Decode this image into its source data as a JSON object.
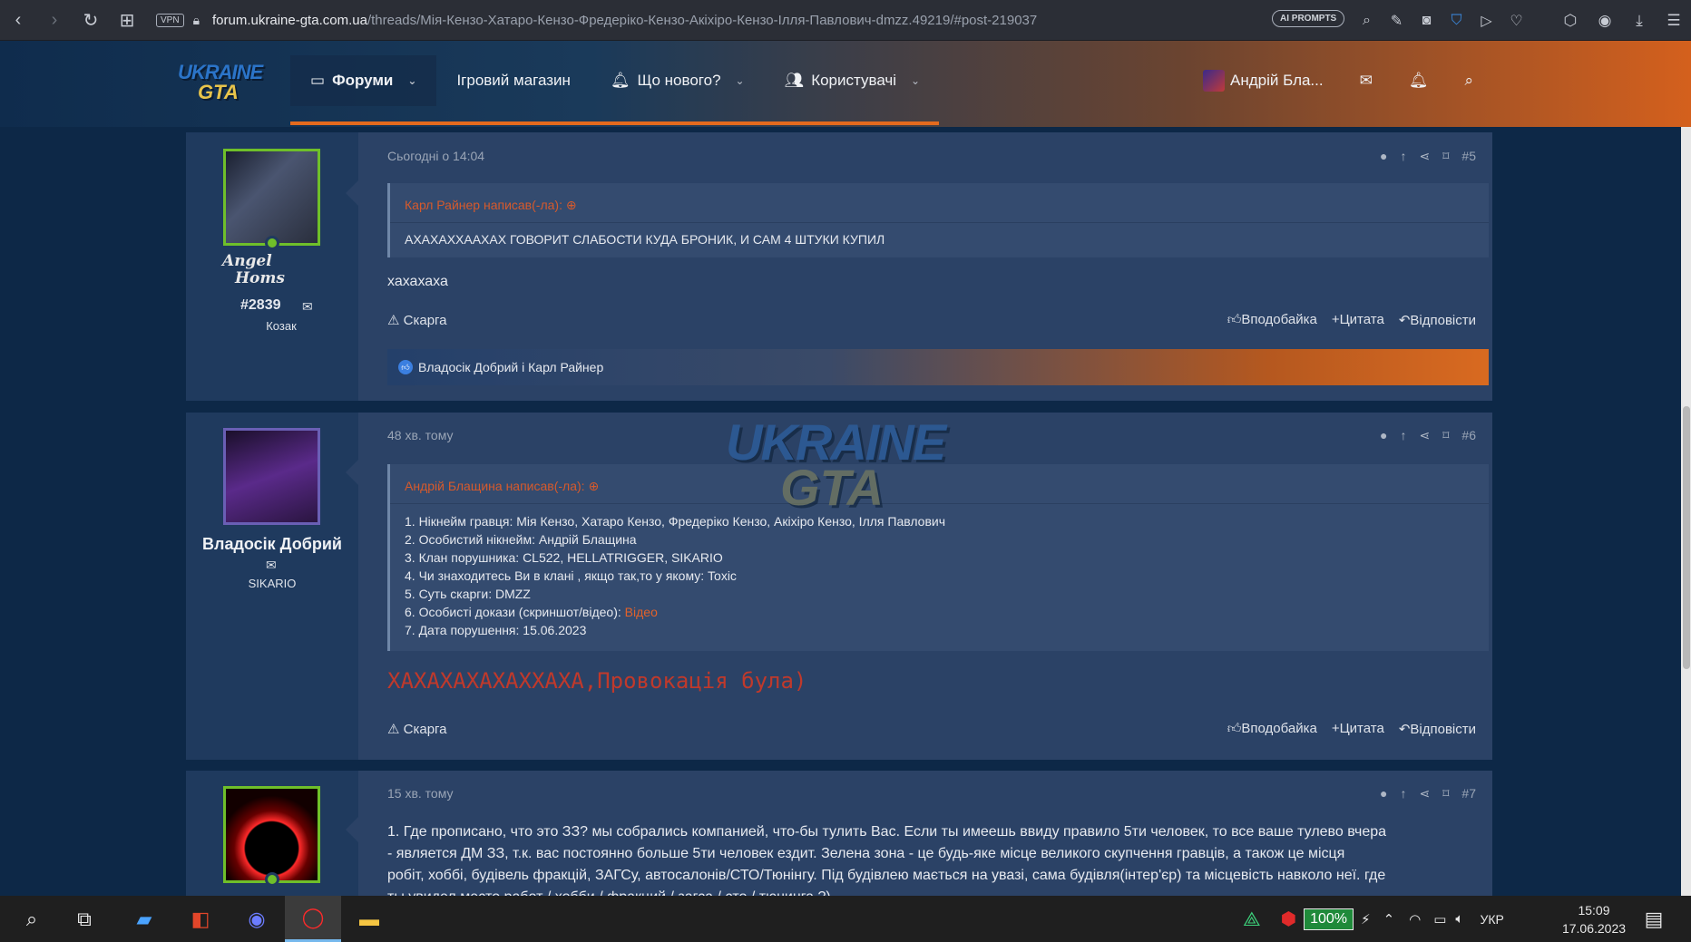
{
  "browser": {
    "vpn": "VPN",
    "url_host": "forum.ukraine-gta.com.ua",
    "url_path": "/threads/Мія-Кензо-Хатаро-Кензо-Фредеріко-Кензо-Акіхіро-Кензо-Ілля-Павлович-dmzz.49219/#post-219037",
    "ai_prompts": "AI PROMPTS"
  },
  "logo": {
    "line1": "UKRAINE",
    "line2": "GTA"
  },
  "nav": {
    "forums": "Форуми",
    "shop": "Ігровий магазин",
    "whats_new": "Що нового?",
    "users": "Користувачі",
    "account_name": "Андрій Бла..."
  },
  "posts": [
    {
      "time": "Сьогодні о 14:04",
      "number": "#5",
      "username_line1": "Angel",
      "username_line2": "Homs",
      "user_id": "#2839",
      "user_title": "Козак",
      "quote_header": "Карл Райнер написав(-ла):",
      "quote_lines": [
        "АХАХАХХААХАХ ГОВОРИТ СЛАБОСТИ КУДА БРОНИК, И САМ 4 ШТУКИ КУПИЛ"
      ],
      "text": "хахахаха",
      "reactions": "Владосік Добрий і Карл Райнер"
    },
    {
      "time": "48 хв. тому",
      "number": "#6",
      "username": "Владосік Добрий",
      "user_title": "SIKARIO",
      "quote_header": "Андрій Блащина написав(-ла):",
      "quote_lines": [
        "1. Нікнейм гравця: Мія Кензо, Хатаро Кензо, Фредеріко Кензо, Акіхіро Кензо, Ілля Павлович",
        "2. Особистий нікнейм: Андрій Блащина",
        "3. Клан порушника: CL522, HELLATRIGGER, SIKARIO",
        "4. Чи знаходитесь Ви в клані , якщо так,то у якому: Toxic",
        "5. Суть скарги: DMZZ",
        "6. Особисті докази (скриншот/відео): ",
        "7. Дата порушення: 15.06.2023"
      ],
      "evidence_link": "Відео",
      "text": "ХАХАХАХАХАХХАХА,Провокація була)"
    },
    {
      "time": "15 хв. тому",
      "number": "#7",
      "text_lines": [
        "1. Где прописано, что это ЗЗ? мы собрались компанией, что-бы тулить Вас. Если ты имеешь ввиду правило 5ти человек, то все ваше тулево вчера",
        "- является ДМ ЗЗ, т.к. вас постоянно больше 5ти человек ездит. Зелена зона - це будь-яке місце великого скупчення гравців, а також це місця",
        "робіт, хоббі, будівель фракцій, ЗАГСу, автосалонів/СТО/Тюнінгу. Під будівлею мається на увазі, сама будівля(інтер'єр) та місцевість навколо неї. где",
        "ты увидел место работ / хобби / фракций / загса / сто / тюнинга ?)"
      ]
    }
  ],
  "actions": {
    "report": "Скарга",
    "like": "Вподобайка",
    "quote": "Цитата",
    "reply": "Відповісти"
  },
  "taskbar": {
    "battery": "100%",
    "lang": "УКР",
    "time": "15:09",
    "date": "17.06.2023"
  },
  "colors": {
    "accent_orange": "#e46a1e",
    "quote_header": "#d65a2c",
    "online_green": "#6fbf2a"
  }
}
